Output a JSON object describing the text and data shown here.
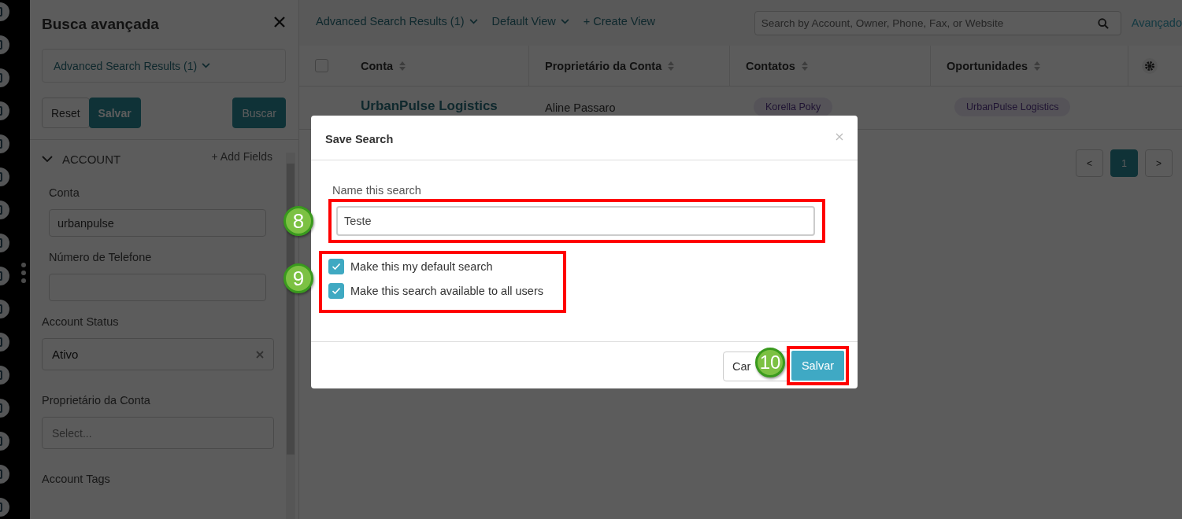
{
  "panel": {
    "title": "Busca avançada",
    "saved_search": "Advanced Search Results (1)",
    "buttons": [
      {
        "label": "Reset",
        "kind": "plain"
      },
      {
        "label": "Salvar",
        "kind": "primary"
      },
      {
        "label": "Buscar",
        "kind": "primary_right"
      }
    ],
    "section": {
      "title": "ACCOUNT",
      "expanded": true,
      "add_fields": "+ Add Fields",
      "fields": [
        {
          "label": "Conta",
          "kind": "text",
          "value": "urbanpulse"
        },
        {
          "label": "Número de Telefone",
          "kind": "text"
        },
        {
          "label": "Account Status",
          "kind": "select",
          "value": "Ativo",
          "clearable": true
        },
        {
          "label": "Proprietário da Conta",
          "kind": "select",
          "placeholder": "Select..."
        },
        {
          "label": "Account Tags",
          "kind": "label"
        }
      ]
    }
  },
  "main": {
    "views": [
      "Advanced Search Results (1)",
      "Default View"
    ],
    "create_view": "+ Create View",
    "search": {
      "placeholder": "Search by Account, Owner, Phone, Fax, or Website"
    },
    "advanced_link": "Avançado",
    "table": {
      "select_all": {
        "checked": false
      },
      "columns": [
        "Conta",
        "Proprietário da Conta",
        "Contatos",
        "Oportunidades"
      ],
      "rows": [
        {
          "cells": [
            {
              "kind": "link",
              "text": "UrbanPulse Logistics"
            },
            {
              "kind": "text",
              "text": "Aline Passaro"
            },
            {
              "kind": "tag",
              "text": "Korella Poky"
            },
            {
              "kind": "tag",
              "text": "UrbanPulse Logistics"
            }
          ]
        }
      ]
    },
    "pagination": [
      {
        "label": "<",
        "selected": false
      },
      {
        "label": "1",
        "selected": true
      },
      {
        "label": ">",
        "selected": false
      }
    ]
  },
  "modal": {
    "title": "Save Search",
    "name_label": "Name this search",
    "name_value": "Teste",
    "name_callout": "8",
    "options_callout": "9",
    "options": [
      {
        "label": "Make this my default search",
        "checked": true
      },
      {
        "label": "Make this search available to all users",
        "checked": true
      }
    ],
    "cancel": "Car",
    "save": "Salvar",
    "save_callout": "10"
  }
}
